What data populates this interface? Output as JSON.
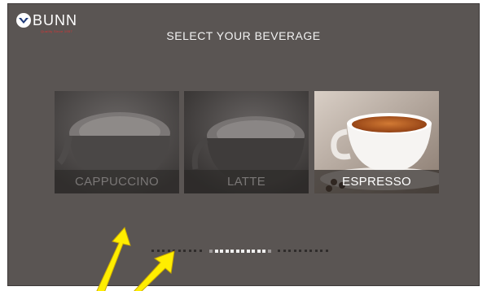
{
  "header": {
    "brand": "BUNN",
    "tagline": "Quality Since 1957",
    "title": "SELECT YOUR BEVERAGE"
  },
  "beverages": [
    {
      "label": "CAPPUCCINO",
      "icon": "coffee-cup-image",
      "state": "dimmed"
    },
    {
      "label": "LATTE",
      "icon": "coffee-cup-image",
      "state": "dimmed"
    },
    {
      "label": "ESPRESSO",
      "icon": "espresso-cup-image",
      "state": "highlighted"
    }
  ],
  "pager": {
    "groups": 3,
    "active_group": 2
  },
  "colors": {
    "background": "#5a5553",
    "brand_red": "#d33333",
    "annotation_arrow": "#ffee00",
    "espresso": "#b0521a"
  }
}
